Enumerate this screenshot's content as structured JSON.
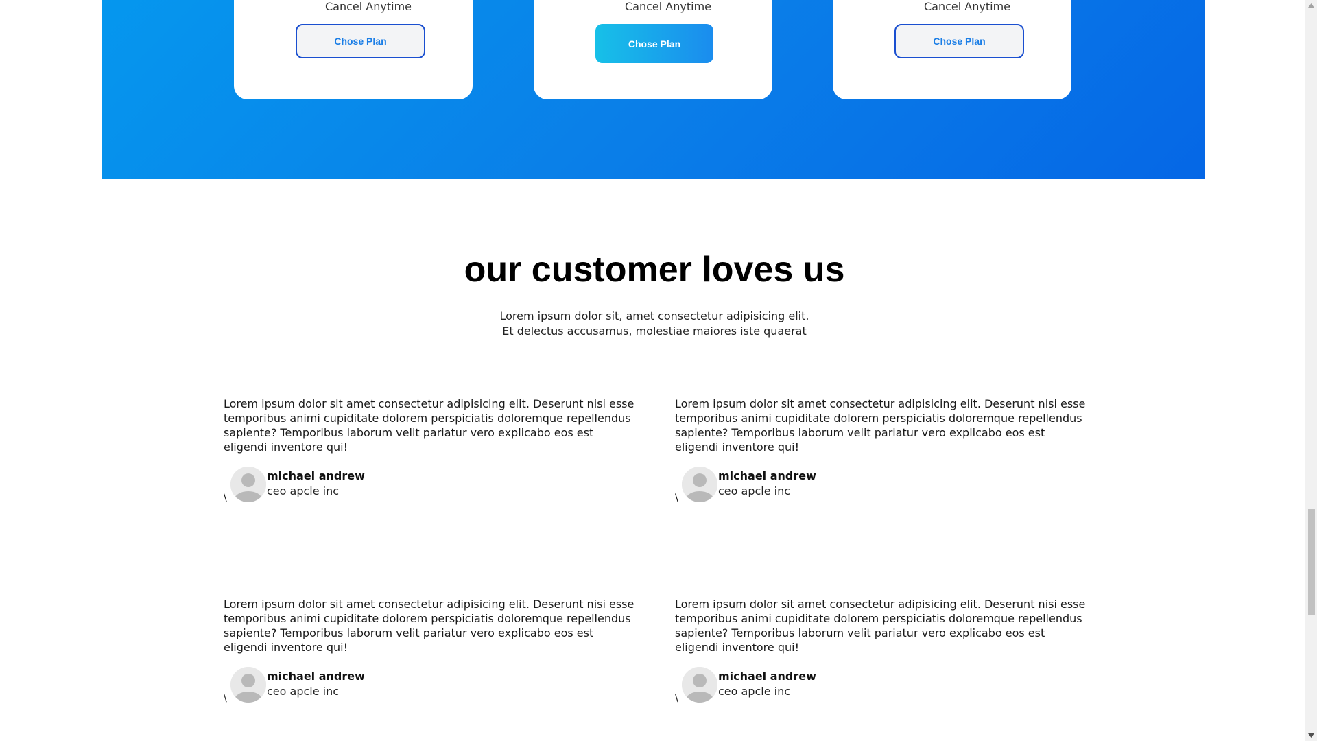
{
  "pricing": {
    "cards": [
      {
        "cancel_text": "Cancel Anytime",
        "button_label": "Chose Plan",
        "style": "outline"
      },
      {
        "cancel_text": "Cancel Anytime",
        "button_label": "Chose Plan",
        "style": "filled"
      },
      {
        "cancel_text": "Cancel Anytime",
        "button_label": "Chose Plan",
        "style": "outline"
      }
    ]
  },
  "testimonials": {
    "title": "our customer loves us",
    "subtitle_line1": "Lorem ipsum dolor sit, amet consectetur adipisicing elit.",
    "subtitle_line2": "Et delectus accusamus, molestiae maiores iste quaerat",
    "items": [
      {
        "quote": "Lorem ipsum dolor sit amet consectetur adipisicing elit. Deserunt nisi esse temporibus animi cupiditate dolorem perspiciatis doloremque repellendus sapiente? Temporibus laborum velit pariatur vero explicabo eos est eligendi inventore qui!",
        "name": "michael andrew",
        "role": "ceo apcle inc",
        "stray_char": "\\"
      },
      {
        "quote": "Lorem ipsum dolor sit amet consectetur adipisicing elit. Deserunt nisi esse temporibus animi cupiditate dolorem perspiciatis doloremque repellendus sapiente? Temporibus laborum velit pariatur vero explicabo eos est eligendi inventore qui!",
        "name": "michael andrew",
        "role": "ceo apcle inc",
        "stray_char": "\\"
      },
      {
        "quote": "Lorem ipsum dolor sit amet consectetur adipisicing elit. Deserunt nisi esse temporibus animi cupiditate dolorem perspiciatis doloremque repellendus sapiente? Temporibus laborum velit pariatur vero explicabo eos est eligendi inventore qui!",
        "name": "michael andrew",
        "role": "ceo apcle inc",
        "stray_char": "\\"
      },
      {
        "quote": "Lorem ipsum dolor sit amet consectetur adipisicing elit. Deserunt nisi esse temporibus animi cupiditate dolorem perspiciatis doloremque repellendus sapiente? Temporibus laborum velit pariatur vero explicabo eos est eligendi inventore qui!",
        "name": "michael andrew",
        "role": "ceo apcle inc",
        "stray_char": "\\"
      }
    ]
  },
  "colors": {
    "band_gradient_start": "#0597ee",
    "band_gradient_end": "#0567e6",
    "button_outline_border": "#1a4fd0",
    "button_outline_text": "#1b7ee6",
    "button_filled_start": "#17c0e8",
    "button_filled_end": "#1a8cee"
  },
  "icons": {
    "avatar": "user-avatar-icon",
    "scroll_up": "scroll-up-arrow-icon",
    "scroll_down": "scroll-down-arrow-icon"
  }
}
